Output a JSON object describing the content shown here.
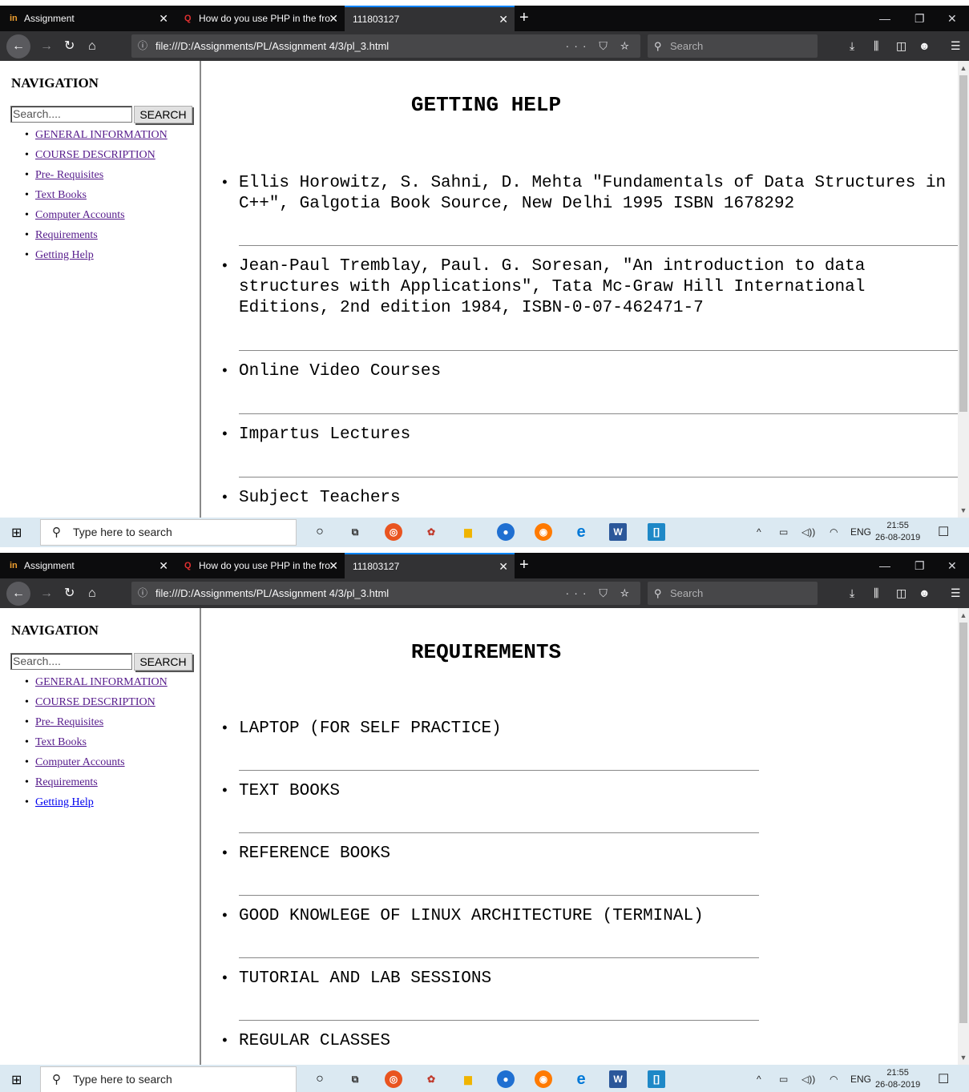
{
  "browser": {
    "tabs": [
      {
        "title": "Assignment",
        "icon_text": "in"
      },
      {
        "title": "How do you use PHP in the fro",
        "icon_text": "Q"
      },
      {
        "title": "111803127",
        "icon_text": ""
      }
    ],
    "new_tab": "+",
    "url": "file:///D:/Assignments/PL/Assignment 4/3/pl_3.html",
    "url_actions": "··· ⛉ ☆",
    "search_placeholder": "Search",
    "window_controls": [
      "—",
      "❐",
      "✕"
    ],
    "toolbar_icons": [
      "⤓",
      "⫼",
      "◫",
      "☻",
      "☰"
    ]
  },
  "sidebar": {
    "heading": "NAVIGATION",
    "search_value": "Search....",
    "search_button": "SEARCH",
    "items": [
      {
        "label": "GENERAL INFORMATION"
      },
      {
        "label": "COURSE DESCRIPTION"
      },
      {
        "label": "Pre- Requisites"
      },
      {
        "label": "Text Books"
      },
      {
        "label": "Computer Accounts"
      },
      {
        "label": "Requirements"
      },
      {
        "label": "Getting Help"
      }
    ]
  },
  "screens": [
    {
      "heading": "GETTING HELP",
      "items": [
        "Ellis Horowitz, S. Sahni, D. Mehta \"Fundamentals of Data Structures in C++\", Galgotia Book Source, New Delhi 1995 ISBN 1678292",
        "Jean-Paul Tremblay, Paul. G. Soresan, \"An introduction to data structures with Applications\", Tata Mc-Graw Hill International Editions, 2nd edition 1984, ISBN-0-07-462471-7",
        "Online Video Courses",
        "Impartus Lectures",
        "Subject Teachers"
      ]
    },
    {
      "heading": "REQUIREMENTS",
      "items": [
        "LAPTOP (FOR SELF PRACTICE)",
        "TEXT BOOKS",
        "REFERENCE BOOKS",
        "GOOD KNOWLEGE OF LINUX ARCHITECTURE (TERMINAL)",
        "TUTORIAL AND LAB SESSIONS",
        "REGULAR CLASSES"
      ]
    }
  ],
  "taskbar": {
    "search_placeholder": "Type here to search",
    "tray_lang": "ENG",
    "time": "21:55",
    "date": "26-08-2019",
    "app_icons": [
      "cortana",
      "task-view",
      "ubuntu",
      "app-red",
      "file-explorer",
      "browser-blue",
      "firefox",
      "edge",
      "word",
      "brackets"
    ]
  }
}
